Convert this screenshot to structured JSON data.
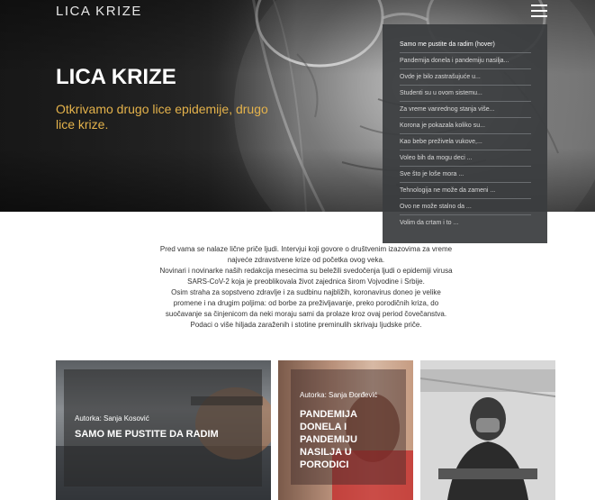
{
  "header": {
    "site_title": "LICA KRIZE",
    "menu_icon": "hamburger-menu-icon"
  },
  "hero": {
    "title": "LICA KRIZE",
    "subtitle": "Otkrivamo drugo lice epidemije, drugo lice krize.",
    "subtitle_color": "#e4b24b"
  },
  "dropdown": {
    "items": [
      "Samo me pustite da radim (hover)",
      "Pandemija donela i pandemiju nasilja...",
      "Ovde je bilo zastrašujuće u...",
      "Studenti su u ovom sistemu...",
      "Za vreme vanrednog stanja više...",
      "Korona je pokazala koliko su...",
      "Kao bebe preživela vukove,...",
      "Voleo bih da mogu deci ...",
      "Sve što je loše mora ...",
      "Tehnologija ne može da zameni ...",
      "Ovo ne može stalno da ...",
      "Volim da crtam i to ..."
    ]
  },
  "intro": {
    "lines": [
      "Pred vama se nalaze lične priče ljudi. Intervjui koji govore o društvenim izazovima za vreme",
      "najveće zdravstvene krize od početka ovog veka.",
      "Novinari i novinarke naših redakcija mesecima su beležili svedočenja ljudi o epidemiji virusa",
      "SARS-CoV-2 koja je preoblikovala život zajednica širom Vojvodine i Srbije.",
      "Osim straha za sopstveno zdravlje i za sudbinu najbližih, koronavirus doneo je velike",
      "promene i na drugim poljima: od borbe za preživljavanje, preko porodičnih kriza, do",
      "suočavanje sa činjenicom da neki moraju sami da prolaze kroz ovaj period čovečanstva.",
      "Podaci o više hiljada zaraženih i stotine preminulih skrivaju ljudske priče."
    ]
  },
  "cards": [
    {
      "author": "Autorka: Sanja Kosović",
      "title": "SAMO ME PUSTITE DA RADIM"
    },
    {
      "author": "Autorka: Sanja Đorđević",
      "title": "PANDEMIJA DONELA I PANDEMIJU NASILJA U PORODICI"
    },
    {
      "author": "",
      "title": ""
    }
  ]
}
